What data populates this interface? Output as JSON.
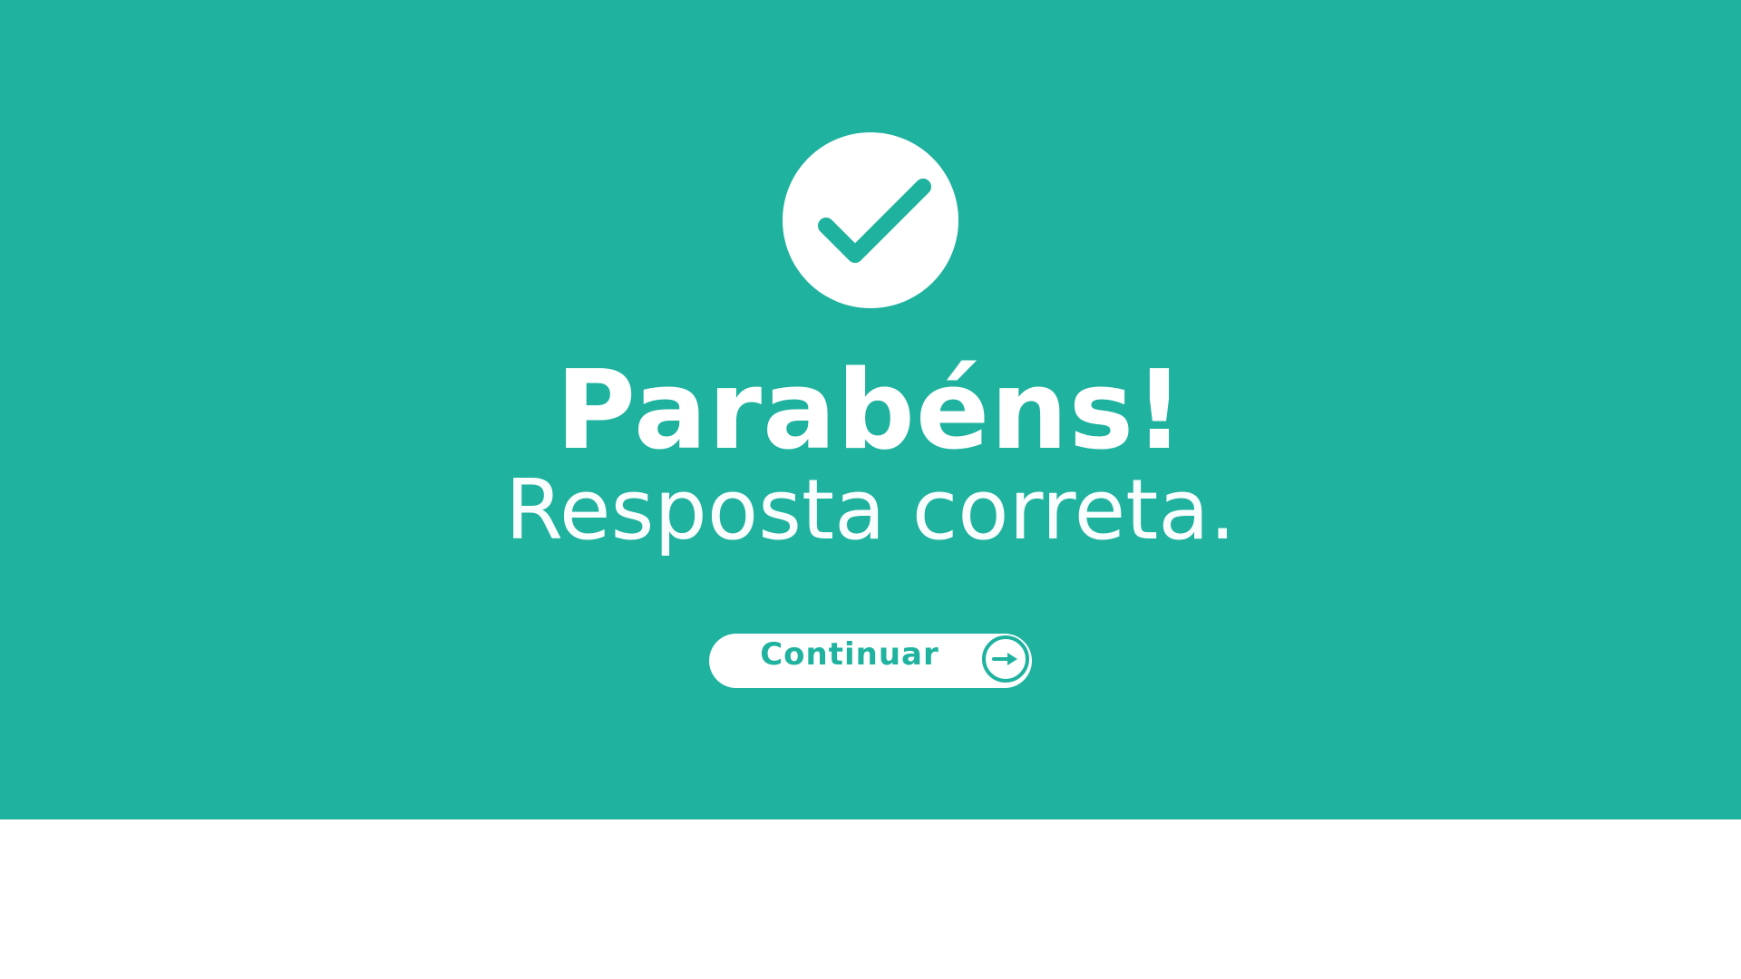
{
  "feedback": {
    "icon": "checkmark-icon",
    "title": "Parabéns!",
    "message": "Resposta correta."
  },
  "continue_button": {
    "label": "Continuar",
    "icon": "arrow-right-icon"
  },
  "colors": {
    "accent": "#1fb29f",
    "background_bottom": "#ffffff",
    "foreground": "#ffffff"
  }
}
